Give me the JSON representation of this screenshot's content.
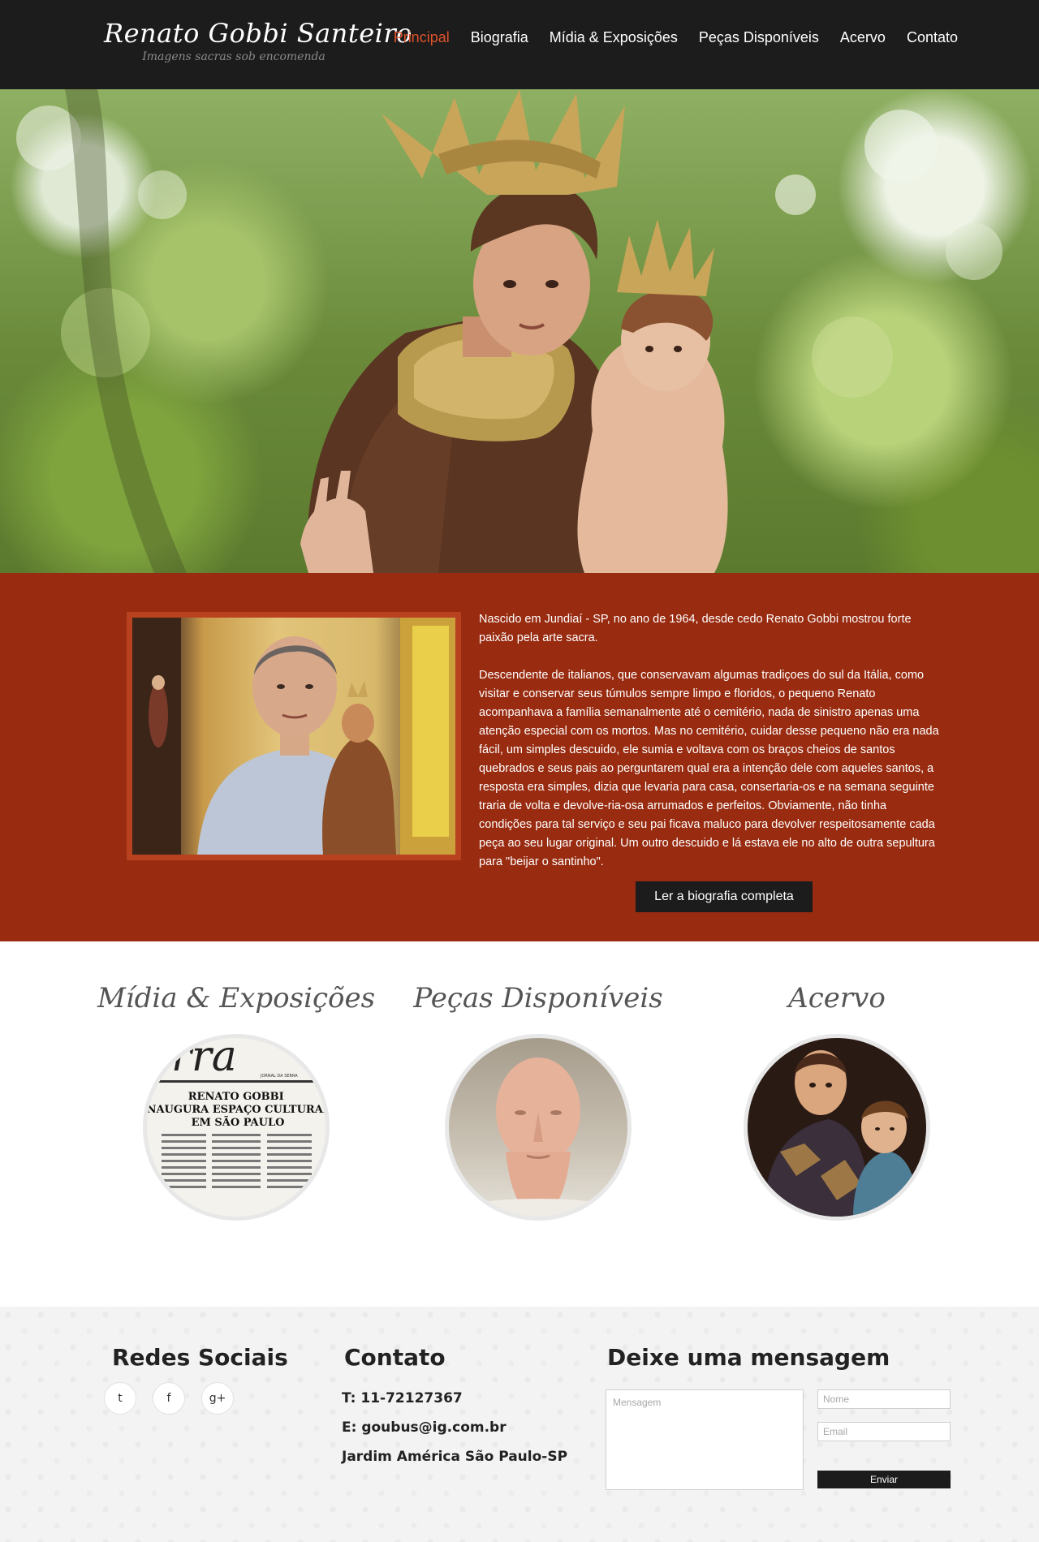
{
  "header": {
    "logo_title": "Renato Gobbi Santeiro",
    "logo_subtitle": "Imagens sacras sob encomenda",
    "nav": [
      {
        "label": "Principal",
        "active": true
      },
      {
        "label": "Biografia",
        "active": false
      },
      {
        "label": "Mídia & Exposições",
        "active": false
      },
      {
        "label": "Peças Disponíveis",
        "active": false
      },
      {
        "label": "Acervo",
        "active": false
      },
      {
        "label": "Contato",
        "active": false
      }
    ]
  },
  "hero": {
    "image": "saint-anthony-with-child-statue"
  },
  "bio": {
    "photo": "artist-portrait-with-statue",
    "paragraphs": [
      "Nascido em Jundiaí - SP, no ano de 1964, desde cedo Renato Gobbi mostrou forte paixão pela arte sacra.",
      "Descendente de italianos, que conservavam algumas tradiçoes do sul da Itália, como visitar e conservar seus túmulos sempre limpo e floridos, o pequeno Renato acompanhava a família semanalmente até o cemitério, nada de sinistro apenas uma atenção especial com os mortos. Mas no cemitério, cuidar desse pequeno não era nada fácil, um simples descuido, ele sumia e voltava com os braços cheios de santos quebrados e seus pais ao perguntarem qual era a intenção dele com aqueles santos, a resposta era simples, dizia que levaria para casa, consertaria-os e na semana seguinte traria de volta  e devolve-ria-osa arrumados e perfeitos. Obviamente, não tinha condições para tal serviço e seu pai ficava maluco para devolver respeitosamente cada peça ao seu lugar original. Um outro descuido e lá estava ele no alto de outra sepultura para \"beijar o santinho\"."
    ],
    "button_label": "Ler a biografia completa"
  },
  "features": [
    {
      "title": "Mídia & Exposições",
      "image": "newspaper-clipping",
      "clipping_masthead": "rra",
      "clipping_paper": "JORNAL DA SERRA",
      "clipping_headline": "RENATO GOBBI INAUGURA ESPAÇO CULTURAL EM SÃO PAULO"
    },
    {
      "title": "Peças Disponíveis",
      "image": "sculpted-head"
    },
    {
      "title": "Acervo",
      "image": "saint-with-child"
    }
  ],
  "footer": {
    "social": {
      "title": "Redes Sociais",
      "icons": [
        {
          "name": "twitter-icon",
          "glyph": "t"
        },
        {
          "name": "facebook-icon",
          "glyph": "f"
        },
        {
          "name": "google-plus-icon",
          "glyph": "g+"
        }
      ]
    },
    "contact": {
      "title": "Contato",
      "phone": "T: 11-72127367",
      "email": "E: goubus@ig.com.br",
      "address": "Jardim América São Paulo-SP"
    },
    "message": {
      "title": "Deixe uma mensagem",
      "message_placeholder": "Mensagem",
      "name_placeholder": "Nome",
      "email_placeholder": "Email",
      "button_label": "Enviar"
    }
  }
}
